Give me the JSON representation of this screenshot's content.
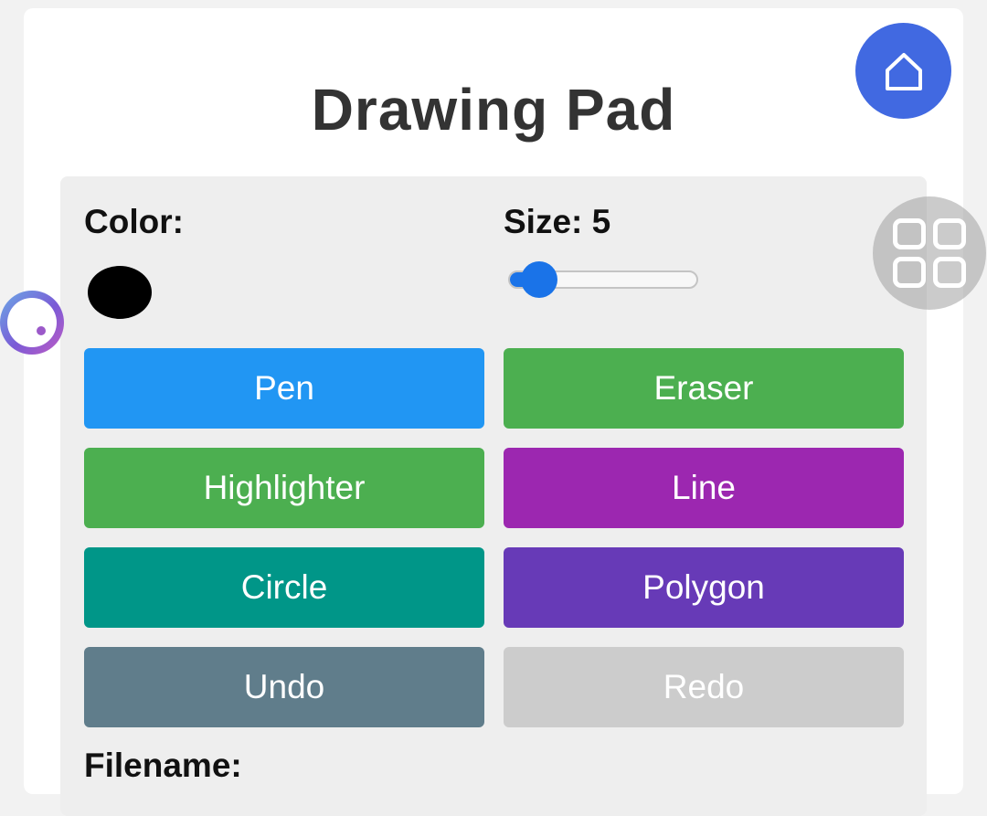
{
  "page": {
    "title": "Drawing Pad"
  },
  "colors": {
    "home_button": "#4169e1",
    "selected_color": "#000000",
    "slider": "#1a73e8"
  },
  "controls": {
    "color_label": "Color:",
    "size_label": "Size: 5",
    "size_value": 5,
    "filename_label": "Filename:"
  },
  "tools": [
    {
      "label": "Pen",
      "color": "#2196f3"
    },
    {
      "label": "Eraser",
      "color": "#4caf50"
    },
    {
      "label": "Highlighter",
      "color": "#4caf50"
    },
    {
      "label": "Line",
      "color": "#9c27b0"
    },
    {
      "label": "Circle",
      "color": "#009688"
    },
    {
      "label": "Polygon",
      "color": "#673ab7"
    },
    {
      "label": "Undo",
      "color": "#607d8b"
    },
    {
      "label": "Redo",
      "color": "#cccccc",
      "disabled": true
    }
  ],
  "icons": {
    "home": "home-icon",
    "floating_menu": "grid-menu-icon",
    "assistant": "assistant-bubble-icon"
  }
}
